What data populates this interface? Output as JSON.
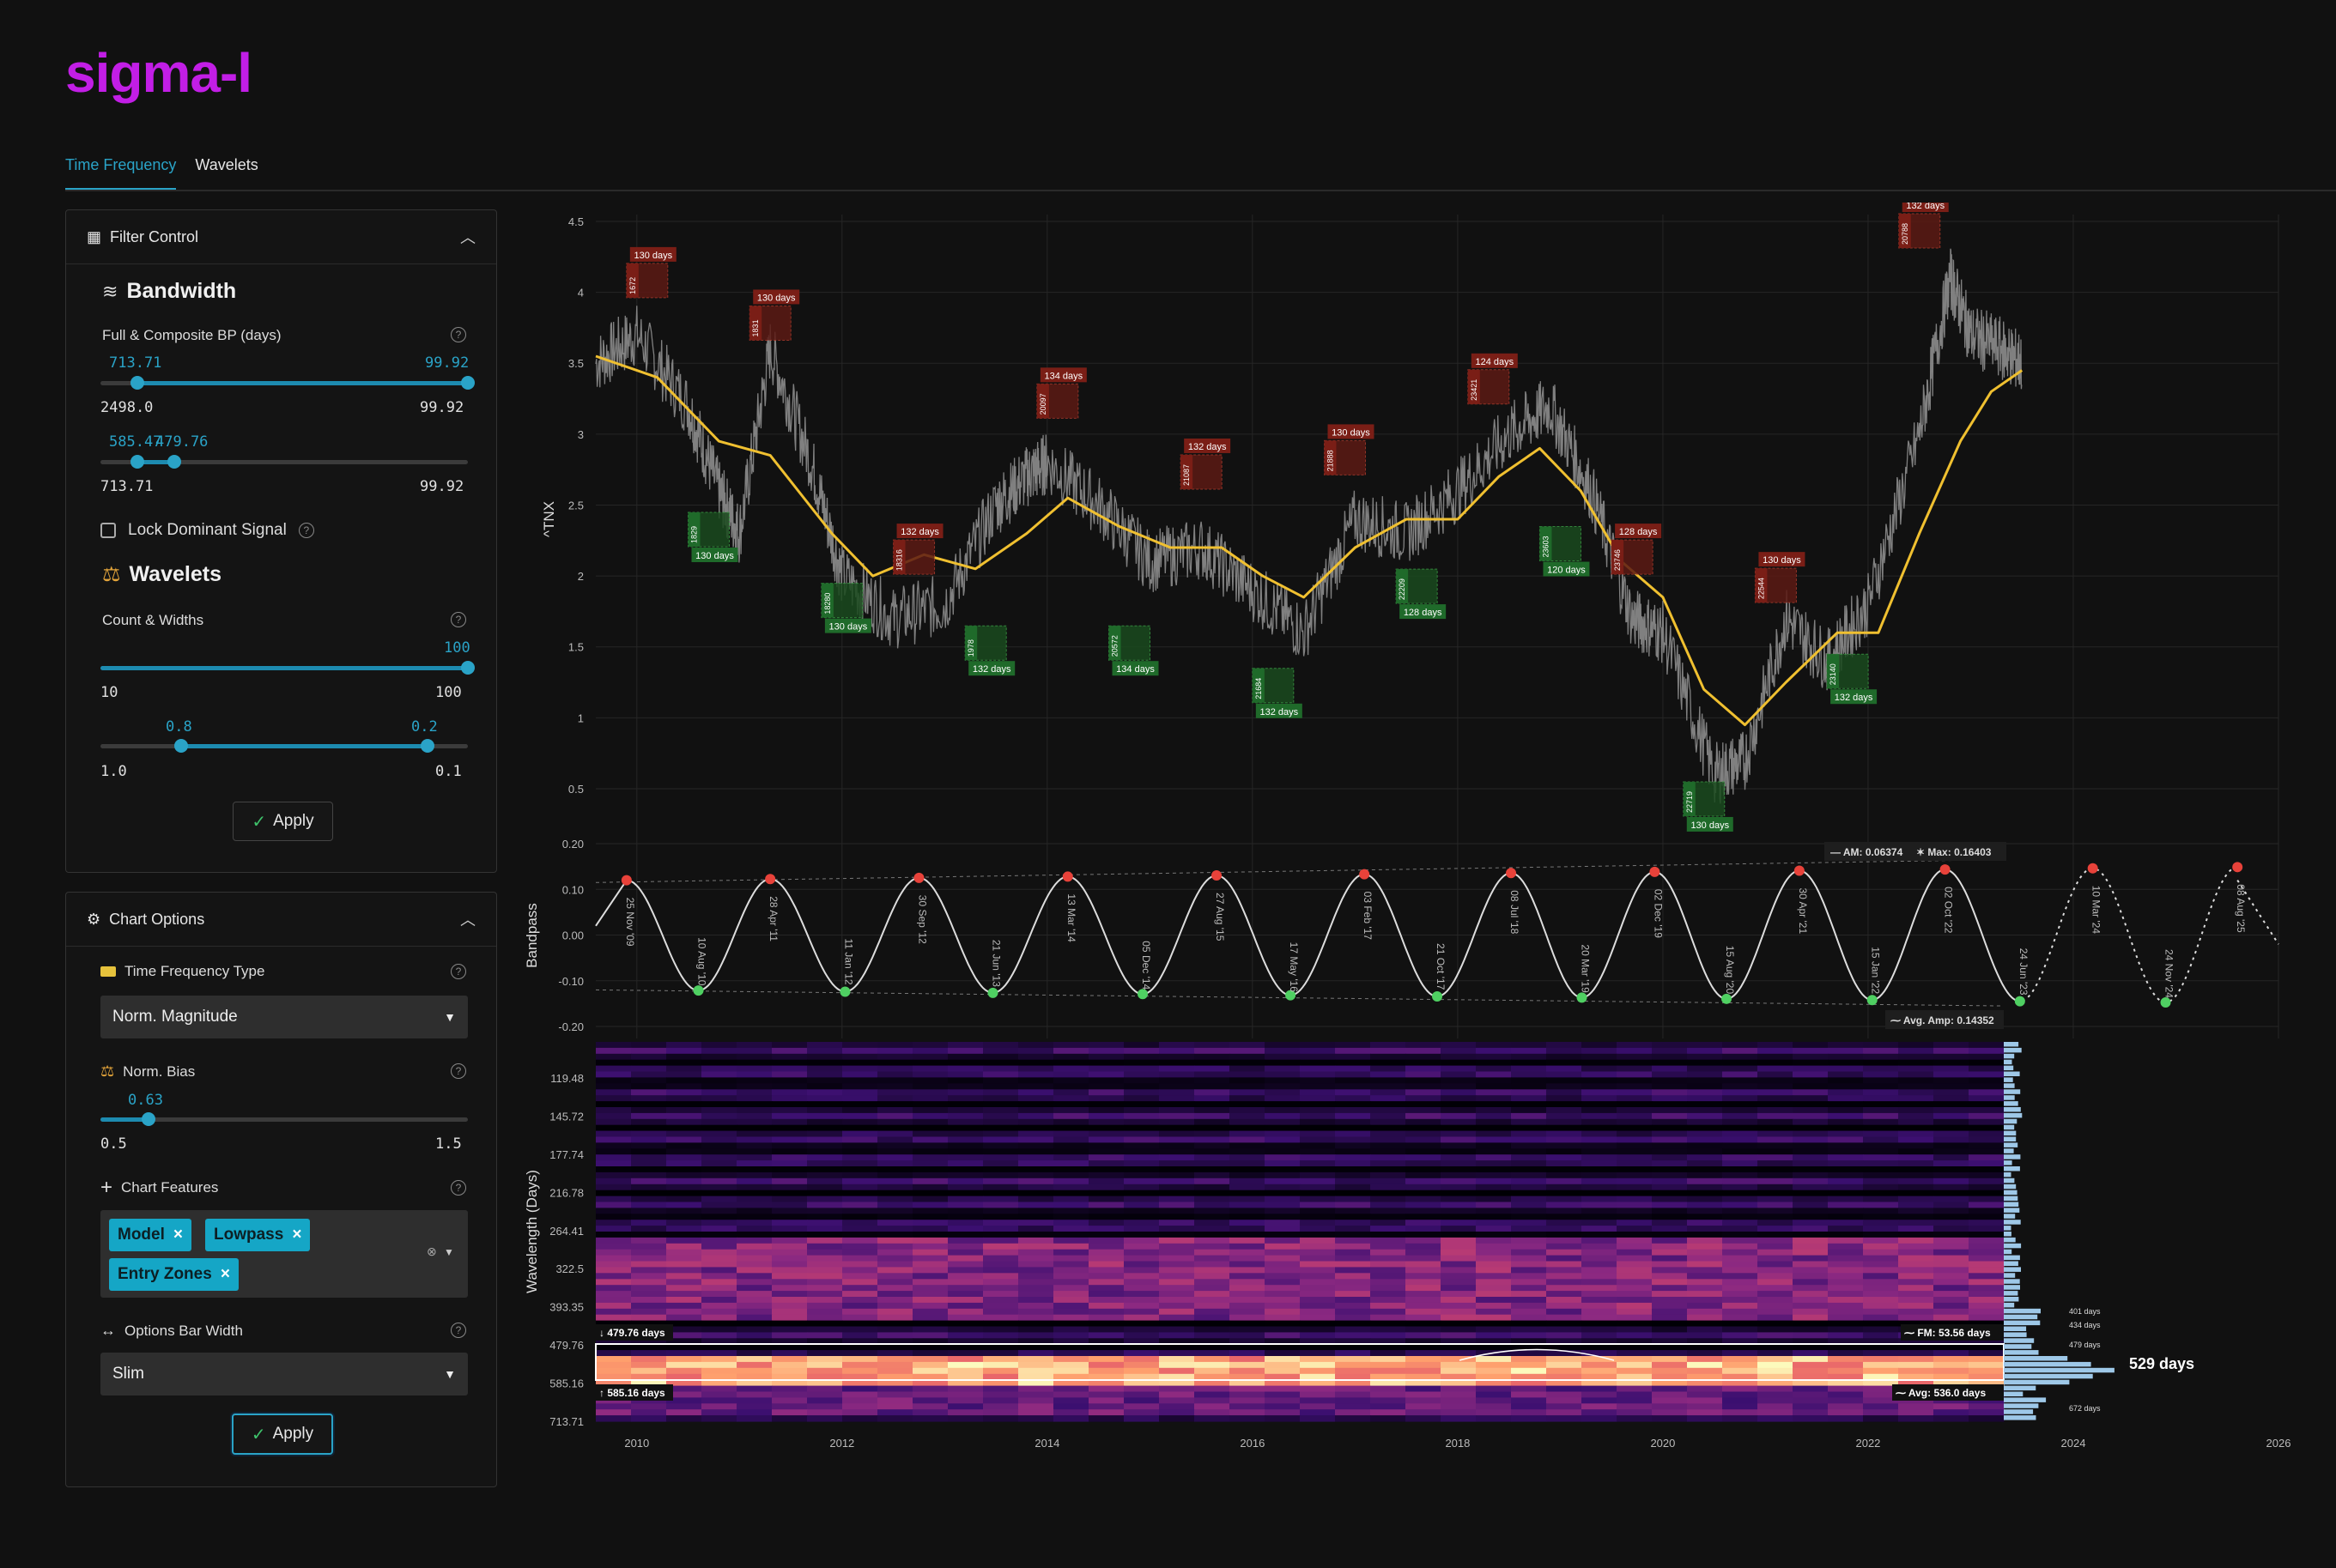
{
  "app": {
    "logo": "sigma-l"
  },
  "tabs": [
    {
      "label": "Time Frequency",
      "active": true
    },
    {
      "label": "Wavelets",
      "active": false
    }
  ],
  "filter_control": {
    "title": "Filter Control",
    "bandwidth": {
      "title": "Bandwidth",
      "label": "Full & Composite BP (days)",
      "slider1": {
        "left_value": "713.71",
        "right_value": "99.92",
        "min": "2498.0",
        "max": "99.92",
        "low_frac": 0.1,
        "high_frac": 1.0
      },
      "slider2": {
        "left_value": "585.47",
        "right_value": "479.76",
        "min": "713.71",
        "max": "99.92",
        "low_frac": 0.1,
        "high_frac": 0.2
      }
    },
    "lock_dominant": {
      "label": "Lock Dominant Signal",
      "checked": false
    },
    "wavelets": {
      "title": "Wavelets",
      "label": "Count & Widths",
      "slider1": {
        "value": "100",
        "min": "10",
        "max": "100",
        "frac": 1.0
      },
      "slider2": {
        "left_value": "0.8",
        "right_value": "0.2",
        "min": "1.0",
        "max": "0.1",
        "low_frac": 0.22,
        "high_frac": 0.89
      }
    },
    "apply_label": "Apply"
  },
  "chart_options": {
    "title": "Chart Options",
    "tf_type": {
      "label": "Time Frequency Type",
      "value": "Norm. Magnitude"
    },
    "norm_bias": {
      "label": "Norm. Bias",
      "value": "0.63",
      "min": "0.5",
      "max": "1.5",
      "frac": 0.13
    },
    "features": {
      "label": "Chart Features",
      "chips": [
        "Model",
        "Lowpass",
        "Entry Zones"
      ]
    },
    "bar_width": {
      "label": "Options Bar Width",
      "value": "Slim"
    },
    "apply_label": "Apply"
  },
  "chart_data": [
    {
      "type": "line",
      "ylabel": "^TNX",
      "ylim": [
        0.3,
        4.5
      ],
      "yticks": [
        "4.5",
        "4",
        "3.5",
        "3",
        "2.5",
        "2",
        "1.5",
        "1",
        "0.5"
      ],
      "xlim": [
        2009.6,
        2026.0
      ],
      "series": [
        {
          "x": [
            2009.6,
            2010.0,
            2010.5,
            2010.8,
            2011.0,
            2011.3,
            2011.7,
            2012.0,
            2012.5,
            2013.0,
            2013.5,
            2013.8,
            2014.0,
            2014.5,
            2015.0,
            2015.5,
            2016.0,
            2016.5,
            2017.0,
            2017.5,
            2018.0,
            2018.5,
            2018.9,
            2019.3,
            2019.7,
            2020.0,
            2020.5,
            2020.8,
            2021.2,
            2021.6,
            2022.0,
            2022.5,
            2022.8,
            2023.0,
            2023.3,
            2023.5
          ],
          "y": [
            3.5,
            3.7,
            3.2,
            2.6,
            2.3,
            3.6,
            2.8,
            2.0,
            1.7,
            1.8,
            2.5,
            2.7,
            2.8,
            2.5,
            2.1,
            2.2,
            1.9,
            1.6,
            2.4,
            2.3,
            2.6,
            3.0,
            3.2,
            2.6,
            1.7,
            1.6,
            0.6,
            0.7,
            1.7,
            1.4,
            1.8,
            3.0,
            4.1,
            3.7,
            3.6,
            3.5
          ]
        },
        {
          "name": "Lowpass",
          "x": [
            2009.6,
            2010.2,
            2010.8,
            2011.3,
            2011.9,
            2012.3,
            2012.8,
            2013.3,
            2013.8,
            2014.2,
            2014.7,
            2015.2,
            2015.7,
            2016.1,
            2016.5,
            2017.0,
            2017.5,
            2018.0,
            2018.4,
            2018.8,
            2019.2,
            2019.6,
            2020.0,
            2020.4,
            2020.8,
            2021.2,
            2021.7,
            2022.1,
            2022.5,
            2022.9,
            2023.2,
            2023.5
          ],
          "y": [
            3.55,
            3.4,
            2.95,
            2.85,
            2.3,
            2.0,
            2.15,
            2.05,
            2.3,
            2.55,
            2.35,
            2.2,
            2.2,
            2.0,
            1.85,
            2.2,
            2.4,
            2.4,
            2.7,
            2.9,
            2.6,
            2.1,
            1.85,
            1.2,
            0.95,
            1.25,
            1.6,
            1.6,
            2.3,
            2.95,
            3.3,
            3.45
          ]
        }
      ],
      "annotations": [
        {
          "kind": "peak",
          "label": "130 days",
          "id": "1672",
          "x": 2010.0,
          "y": 3.95
        },
        {
          "kind": "trough",
          "label": "130 days",
          "id": "1829",
          "x": 2010.6,
          "y": 2.4
        },
        {
          "kind": "peak",
          "label": "130 days",
          "id": "1831",
          "x": 2011.2,
          "y": 3.65
        },
        {
          "kind": "trough",
          "label": "130 days",
          "id": "18280",
          "x": 2011.9,
          "y": 1.9
        },
        {
          "kind": "peak",
          "label": "132 days",
          "id": "18316",
          "x": 2012.6,
          "y": 2.0
        },
        {
          "kind": "trough",
          "label": "132 days",
          "id": "1978",
          "x": 2013.3,
          "y": 1.6
        },
        {
          "kind": "peak",
          "label": "134 days",
          "id": "20097",
          "x": 2014.0,
          "y": 3.1
        },
        {
          "kind": "trough",
          "label": "134 days",
          "id": "20572",
          "x": 2014.7,
          "y": 1.6
        },
        {
          "kind": "peak",
          "label": "132 days",
          "id": "21087",
          "x": 2015.4,
          "y": 2.6
        },
        {
          "kind": "trough",
          "label": "132 days",
          "id": "21684",
          "x": 2016.1,
          "y": 1.3
        },
        {
          "kind": "peak",
          "label": "130 days",
          "id": "21888",
          "x": 2016.8,
          "y": 2.7
        },
        {
          "kind": "trough",
          "label": "128 days",
          "id": "22209",
          "x": 2017.5,
          "y": 2.0
        },
        {
          "kind": "peak",
          "label": "124 days",
          "id": "23421",
          "x": 2018.2,
          "y": 3.2
        },
        {
          "kind": "trough",
          "label": "120 days",
          "id": "23603",
          "x": 2018.9,
          "y": 2.3
        },
        {
          "kind": "peak",
          "label": "128 days",
          "id": "23746",
          "x": 2019.6,
          "y": 2.0
        },
        {
          "kind": "trough",
          "label": "130 days",
          "id": "22719",
          "x": 2020.3,
          "y": 0.5
        },
        {
          "kind": "peak",
          "label": "130 days",
          "id": "22544",
          "x": 2021.0,
          "y": 1.8
        },
        {
          "kind": "trough",
          "label": "132 days",
          "id": "23140",
          "x": 2021.7,
          "y": 1.4
        },
        {
          "kind": "peak",
          "label": "132 days",
          "id": "20788",
          "x": 2022.4,
          "y": 4.3
        }
      ]
    },
    {
      "type": "line",
      "ylabel": "Bandpass",
      "ylim": [
        -0.2,
        0.2
      ],
      "yticks": [
        "0.20",
        "0.10",
        "0.00",
        "-0.10",
        "-0.20"
      ],
      "xlim": [
        2009.6,
        2026.0
      ],
      "legend": {
        "am": "AM: 0.06374",
        "max": "Max: 0.16403",
        "avg_amp": "Avg. Amp: 0.14352"
      },
      "events": [
        {
          "kind": "peak",
          "date": "25 Nov '09",
          "x": 2009.9
        },
        {
          "kind": "trough",
          "date": "10 Aug '10",
          "x": 2010.6
        },
        {
          "kind": "peak",
          "date": "28 Apr '11",
          "x": 2011.3
        },
        {
          "kind": "trough",
          "date": "11 Jan '12",
          "x": 2012.03
        },
        {
          "kind": "peak",
          "date": "30 Sep '12",
          "x": 2012.75
        },
        {
          "kind": "trough",
          "date": "21 Jun '13",
          "x": 2013.47
        },
        {
          "kind": "peak",
          "date": "13 Mar '14",
          "x": 2014.2
        },
        {
          "kind": "trough",
          "date": "05 Dec '14",
          "x": 2014.93
        },
        {
          "kind": "peak",
          "date": "27 Aug '15",
          "x": 2015.65
        },
        {
          "kind": "trough",
          "date": "17 May '16",
          "x": 2016.37
        },
        {
          "kind": "peak",
          "date": "03 Feb '17",
          "x": 2017.09
        },
        {
          "kind": "trough",
          "date": "21 Oct '17",
          "x": 2017.8
        },
        {
          "kind": "peak",
          "date": "08 Jul '18",
          "x": 2018.52
        },
        {
          "kind": "trough",
          "date": "20 Mar '19",
          "x": 2019.21
        },
        {
          "kind": "peak",
          "date": "02 Dec '19",
          "x": 2019.92
        },
        {
          "kind": "trough",
          "date": "15 Aug '20",
          "x": 2020.62
        },
        {
          "kind": "peak",
          "date": "30 Apr '21",
          "x": 2021.33
        },
        {
          "kind": "trough",
          "date": "15 Jan '22",
          "x": 2022.04
        },
        {
          "kind": "peak",
          "date": "02 Oct '22",
          "x": 2022.75
        },
        {
          "kind": "trough",
          "date": "24 Jun '23",
          "x": 2023.48
        },
        {
          "kind": "peak",
          "date": "10 Mar '24",
          "x": 2024.19
        },
        {
          "kind": "trough",
          "date": "24 Nov '24",
          "x": 2024.9
        },
        {
          "kind": "peak",
          "date": "08 Aug '25",
          "x": 2025.6
        }
      ]
    },
    {
      "type": "heatmap",
      "ylabel": "Wavelength (Days)",
      "yticks": [
        "119.48",
        "145.72",
        "177.74",
        "216.78",
        "264.41",
        "322.5",
        "393.35",
        "479.76",
        "585.16",
        "713.71"
      ],
      "xticks": [
        "2010",
        "2012",
        "2014",
        "2016",
        "2018",
        "2020",
        "2022",
        "2024",
        "2026"
      ],
      "xlim": [
        2009.6,
        2026.0
      ],
      "band_labels": {
        "upper": "479.76 days",
        "lower": "585.16 days",
        "fm": "FM: 53.56 days",
        "avg": "Avg: 536.0 days"
      },
      "spectrum_labels": [
        {
          "label": "401 days",
          "major": false
        },
        {
          "label": "434 days",
          "major": false
        },
        {
          "label": "479 days",
          "major": false
        },
        {
          "label": "529 days",
          "major": true
        },
        {
          "label": "672 days",
          "major": false
        }
      ]
    }
  ]
}
